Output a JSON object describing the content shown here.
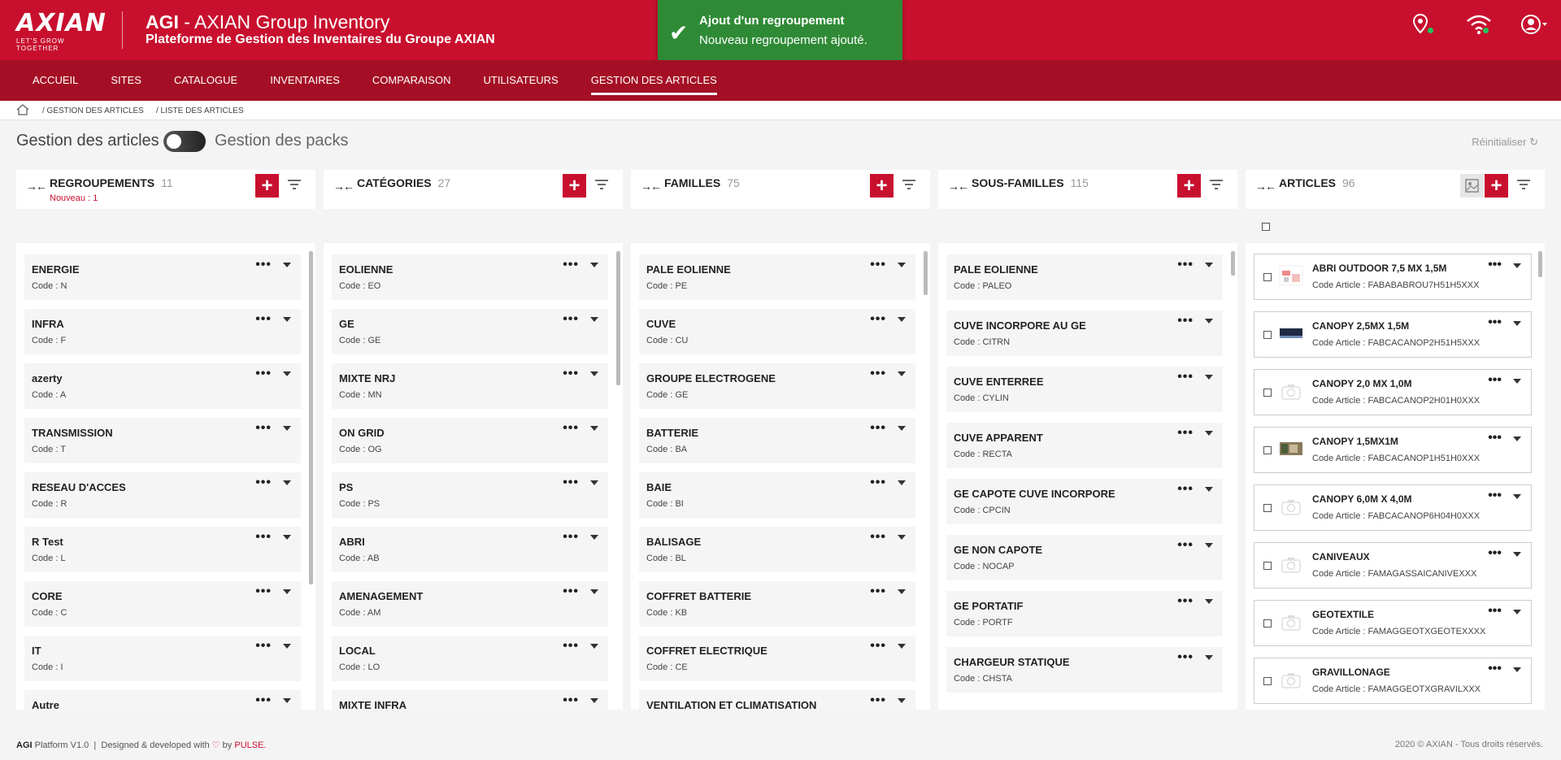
{
  "brand": {
    "logo": "AXIAN",
    "tagline": "LET'S GROW TOGETHER"
  },
  "header": {
    "title_strong": "AGI",
    "title_rest": " - AXIAN Group Inventory",
    "subtitle": "Plateforme de Gestion des Inventaires du Groupe AXIAN",
    "icons": [
      "location-icon",
      "wifi-icon",
      "user-icon"
    ]
  },
  "toast": {
    "title": "Ajout d'un regroupement",
    "message": "Nouveau regroupement ajouté.",
    "color": "#2f8a36"
  },
  "nav": {
    "items": [
      "ACCUEIL",
      "SITES",
      "CATALOGUE",
      "INVENTAIRES",
      "COMPARAISON",
      "UTILISATEURS",
      "GESTION DES ARTICLES"
    ],
    "active": "GESTION DES ARTICLES"
  },
  "breadcrumb": {
    "items": [
      "/ GESTION DES ARTICLES",
      "/ LISTE DES ARTICLES"
    ]
  },
  "page": {
    "title": "Gestion des articles",
    "toggle_label": "Gestion des packs",
    "reset_label": "Réinitialiser"
  },
  "columns": {
    "regroupements": {
      "title": "REGROUPEMENTS",
      "count": "11",
      "new_note": "Nouveau : 1",
      "items": [
        {
          "name": "ENERGIE",
          "code": "N"
        },
        {
          "name": "INFRA",
          "code": "F"
        },
        {
          "name": "azerty",
          "code": "A"
        },
        {
          "name": "TRANSMISSION",
          "code": "T"
        },
        {
          "name": "RESEAU D'ACCES",
          "code": "R"
        },
        {
          "name": "R Test",
          "code": "L"
        },
        {
          "name": "CORE",
          "code": "C"
        },
        {
          "name": "IT",
          "code": "I"
        },
        {
          "name": "Autre",
          "code": ""
        }
      ]
    },
    "categories": {
      "title": "CATÉGORIES",
      "count": "27",
      "items": [
        {
          "name": "EOLIENNE",
          "code": "EO"
        },
        {
          "name": "GE",
          "code": "GE"
        },
        {
          "name": "MIXTE NRJ",
          "code": "MN"
        },
        {
          "name": "ON GRID",
          "code": "OG"
        },
        {
          "name": "PS",
          "code": "PS"
        },
        {
          "name": "ABRI",
          "code": "AB"
        },
        {
          "name": "AMENAGEMENT",
          "code": "AM"
        },
        {
          "name": "LOCAL",
          "code": "LO"
        },
        {
          "name": "MIXTE INFRA",
          "code": ""
        }
      ]
    },
    "familles": {
      "title": "FAMILLES",
      "count": "75",
      "items": [
        {
          "name": "PALE EOLIENNE",
          "code": "PE"
        },
        {
          "name": "CUVE",
          "code": "CU"
        },
        {
          "name": "GROUPE ELECTROGENE",
          "code": "GE"
        },
        {
          "name": "BATTERIE",
          "code": "BA"
        },
        {
          "name": "BAIE",
          "code": "BI"
        },
        {
          "name": "BALISAGE",
          "code": "BL"
        },
        {
          "name": "COFFRET BATTERIE",
          "code": "KB"
        },
        {
          "name": "COFFRET ELECTRIQUE",
          "code": "CE"
        },
        {
          "name": "VENTILATION ET CLIMATISATION",
          "code": ""
        }
      ]
    },
    "sous_familles": {
      "title": "SOUS-FAMILLES",
      "count": "115",
      "items": [
        {
          "name": "PALE EOLIENNE",
          "code": "PALEO"
        },
        {
          "name": "CUVE INCORPORE AU GE",
          "code": "CITRN"
        },
        {
          "name": "CUVE ENTERREE",
          "code": "CYLIN"
        },
        {
          "name": "CUVE APPARENT",
          "code": "RECTA"
        },
        {
          "name": "GE CAPOTE CUVE INCORPORE",
          "code": "CPCIN"
        },
        {
          "name": "GE NON CAPOTE",
          "code": "NOCAP"
        },
        {
          "name": "GE PORTATIF",
          "code": "PORTF"
        },
        {
          "name": "CHARGEUR STATIQUE",
          "code": "CHSTA"
        }
      ]
    },
    "articles": {
      "title": "ARTICLES",
      "count": "96",
      "items": [
        {
          "name": "ABRI OUTDOOR 7,5 MX 1,5M",
          "code": "FABABABROU7H51H5XXX",
          "thumb": "photo-abri"
        },
        {
          "name": "CANOPY 2,5MX 1,5M",
          "code": "FABCACANOP2H51H5XXX",
          "thumb": "photo-canopy"
        },
        {
          "name": "CANOPY 2,0 MX 1,0M",
          "code": "FABCACANOP2H01H0XXX",
          "thumb": "camera-placeholder"
        },
        {
          "name": "CANOPY 1,5MX1M",
          "code": "FABCACANOP1H51H0XXX",
          "thumb": "photo-canopy-2"
        },
        {
          "name": "CANOPY 6,0M X 4,0M",
          "code": "FABCACANOP6H04H0XXX",
          "thumb": "camera-placeholder"
        },
        {
          "name": "CANIVEAUX",
          "code": "FAMAGASSAICANIVEXXX",
          "thumb": "camera-placeholder"
        },
        {
          "name": "GEOTEXTILE",
          "code": "FAMAGGEOTXGEOTEXXXX",
          "thumb": "camera-placeholder"
        },
        {
          "name": "GRAVILLONAGE",
          "code": "FAMAGGEOTXGRAVILXXX",
          "thumb": "camera-placeholder"
        }
      ]
    }
  },
  "labels": {
    "code_prefix": "Code :",
    "article_code_prefix": "Code Article :"
  },
  "footer": {
    "platform": "AGI",
    "platform_rest": " Platform V1.0",
    "separator": "|",
    "designed": " Designed & developed with ",
    "by": " by ",
    "pulse": "PULSE.",
    "copyright": "2020 © AXIAN - Tous droits réservés."
  },
  "colors": {
    "brand_red": "#c8102e",
    "nav_red": "#a40f25",
    "success_green": "#2f8a36"
  }
}
